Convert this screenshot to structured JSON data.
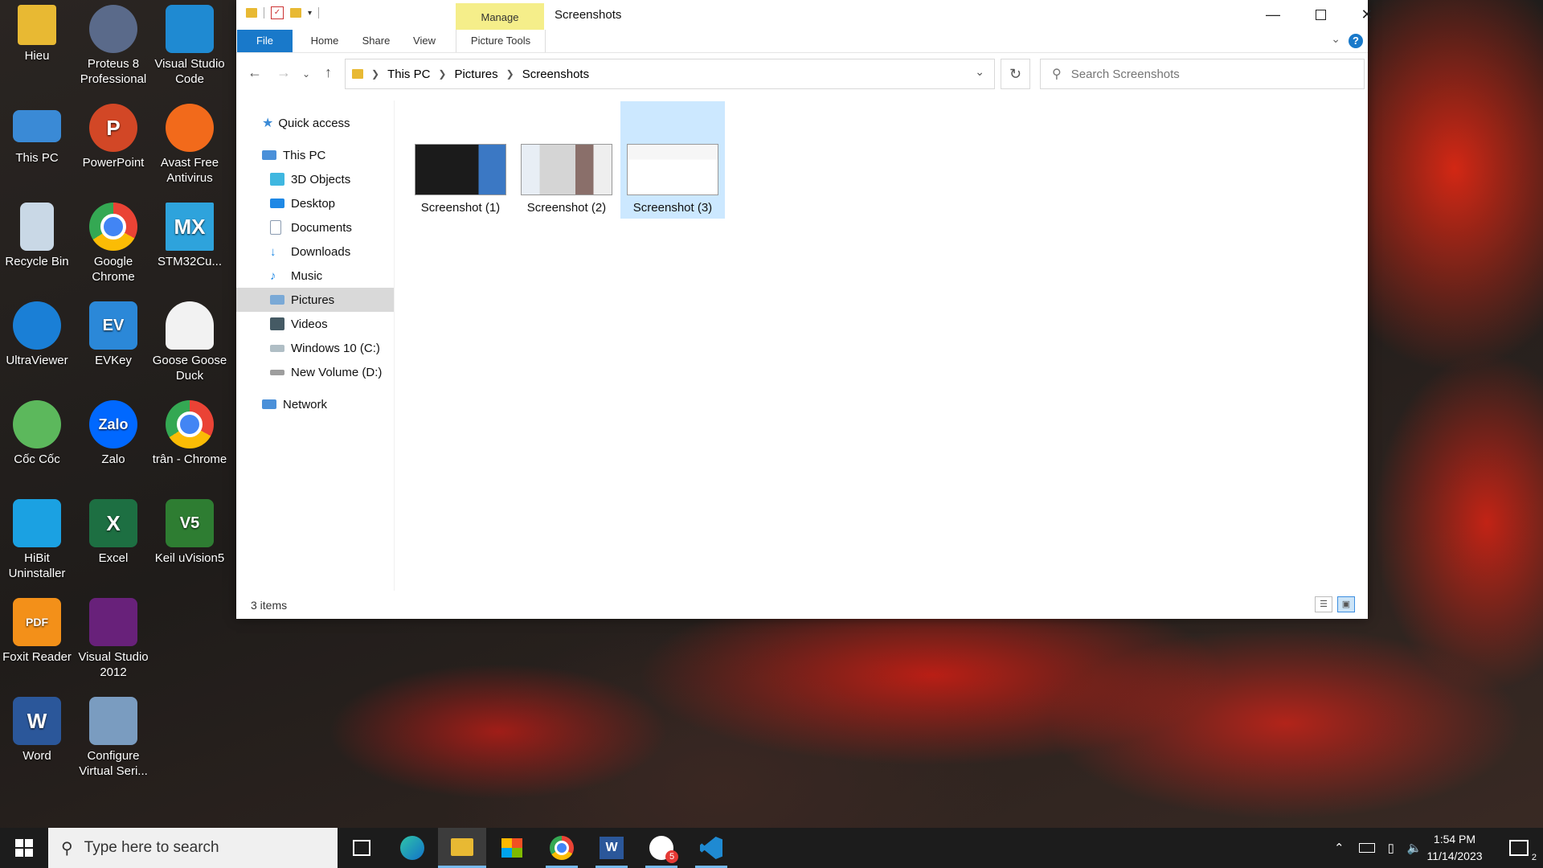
{
  "desktop": {
    "icons": [
      {
        "label": "Hieu",
        "icon": "folder-icon",
        "color": "#e8b933"
      },
      {
        "label": "Proteus 8 Professional",
        "icon": "proteus-icon",
        "color": "#5a6a8a"
      },
      {
        "label": "Visual Studio Code",
        "icon": "vscode-icon",
        "color": "#1f8ad2"
      },
      {
        "label": "This PC",
        "icon": "computer-icon",
        "color": "#3a8ad6"
      },
      {
        "label": "PowerPoint",
        "icon": "powerpoint-icon",
        "color": "#d24726",
        "glyph": "P"
      },
      {
        "label": "Avast Free Antivirus",
        "icon": "avast-icon",
        "color": "#f26a1b"
      },
      {
        "label": "Recycle Bin",
        "icon": "recycle-bin-icon",
        "color": "#c9d8e6"
      },
      {
        "label": "Google Chrome",
        "icon": "chrome-icon",
        "color": "#4285f4"
      },
      {
        "label": "STM32Cu...",
        "icon": "stm32cube-icon",
        "color": "#2ea3dc",
        "glyph": "MX"
      },
      {
        "label": "UltraViewer",
        "icon": "ultraviewer-icon",
        "color": "#1a7fd6"
      },
      {
        "label": "EVKey",
        "icon": "evkey-icon",
        "color": "#2b88d8",
        "glyph": "EV"
      },
      {
        "label": "Goose Goose Duck",
        "icon": "goose-icon",
        "color": "#f2f2f2"
      },
      {
        "label": "Cốc Cốc",
        "icon": "coccoc-icon",
        "color": "#5cb85c"
      },
      {
        "label": "Zalo",
        "icon": "zalo-icon",
        "color": "#0068ff",
        "glyph": "Zalo"
      },
      {
        "label": "trân - Chrome",
        "icon": "chrome-profile-icon",
        "color": "#ea4335"
      },
      {
        "label": "HiBit Uninstaller",
        "icon": "hibit-icon",
        "color": "#1ba1e2"
      },
      {
        "label": "Excel",
        "icon": "excel-icon",
        "color": "#1d6f42",
        "glyph": "X"
      },
      {
        "label": "Keil uVision5",
        "icon": "keil-icon",
        "color": "#2e7d32",
        "glyph": "V5"
      },
      {
        "label": "Foxit Reader",
        "icon": "foxit-icon",
        "color": "#f39019",
        "glyph": "PDF"
      },
      {
        "label": "Visual Studio 2012",
        "icon": "visual-studio-icon",
        "color": "#68217a"
      },
      {
        "label": "Word",
        "icon": "word-icon",
        "color": "#2b579a",
        "glyph": "W"
      },
      {
        "label": "Configure Virtual Seri...",
        "icon": "configure-virtual-serial-icon",
        "color": "#7a9cc0"
      }
    ]
  },
  "explorer": {
    "title": "Screenshots",
    "manage_tab": "Manage",
    "ribbon_tabs": [
      "File",
      "Home",
      "Share",
      "View",
      "Picture Tools"
    ],
    "breadcrumb": [
      "This PC",
      "Pictures",
      "Screenshots"
    ],
    "search_placeholder": "Search Screenshots",
    "nav": {
      "quick_access": "Quick access",
      "this_pc": "This PC",
      "items": [
        "3D Objects",
        "Desktop",
        "Documents",
        "Downloads",
        "Music",
        "Pictures",
        "Videos",
        "Windows 10 (C:)",
        "New Volume (D:)"
      ],
      "network": "Network",
      "selected": "Pictures"
    },
    "files": [
      "Screenshot (1)",
      "Screenshot (2)",
      "Screenshot (3)"
    ],
    "selected_file": "Screenshot (3)",
    "status": "3 items"
  },
  "taskbar": {
    "search_placeholder": "Type here to search",
    "apps": [
      "task-view-icon",
      "edge-icon",
      "file-explorer-icon",
      "microsoft-store-icon",
      "chrome-icon",
      "word-icon",
      "zalo-icon",
      "vscode-icon"
    ],
    "zalo_badge": "5",
    "time": "1:54 PM",
    "date": "11/14/2023",
    "notification_count": "2"
  },
  "colors": {
    "accent": "#1979ca",
    "selection": "#cce8ff",
    "manage_tab": "#f5ee8a",
    "taskbar": "#1c1c1c"
  }
}
